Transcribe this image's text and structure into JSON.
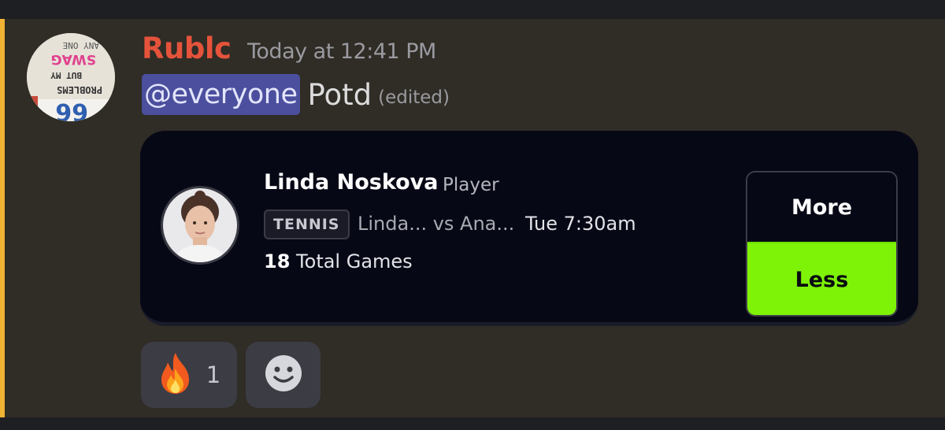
{
  "message": {
    "username": "Rublc",
    "timestamp": "Today at 12:41 PM",
    "mention": "@everyone",
    "text": "Potd",
    "edited_label": "(edited)"
  },
  "card": {
    "player_name": "Linda Noskova",
    "player_role": "Player",
    "sport": "TENNIS",
    "matchup": "Linda... vs Ana...",
    "match_time": "Tue 7:30am",
    "total_value": "18",
    "total_label": "Total Games",
    "more_label": "More",
    "less_label": "Less"
  },
  "reactions": [
    {
      "emoji": "fire-emoji",
      "count": "1"
    }
  ],
  "colors": {
    "username": "#e5533b",
    "mention_bg": "#4b4f9e",
    "mention_bar": "#f0b232",
    "less_button": "#7ef207",
    "card_bg": "#070815"
  },
  "icons": [
    "fire-emoji",
    "add-reaction-smiley-icon"
  ]
}
